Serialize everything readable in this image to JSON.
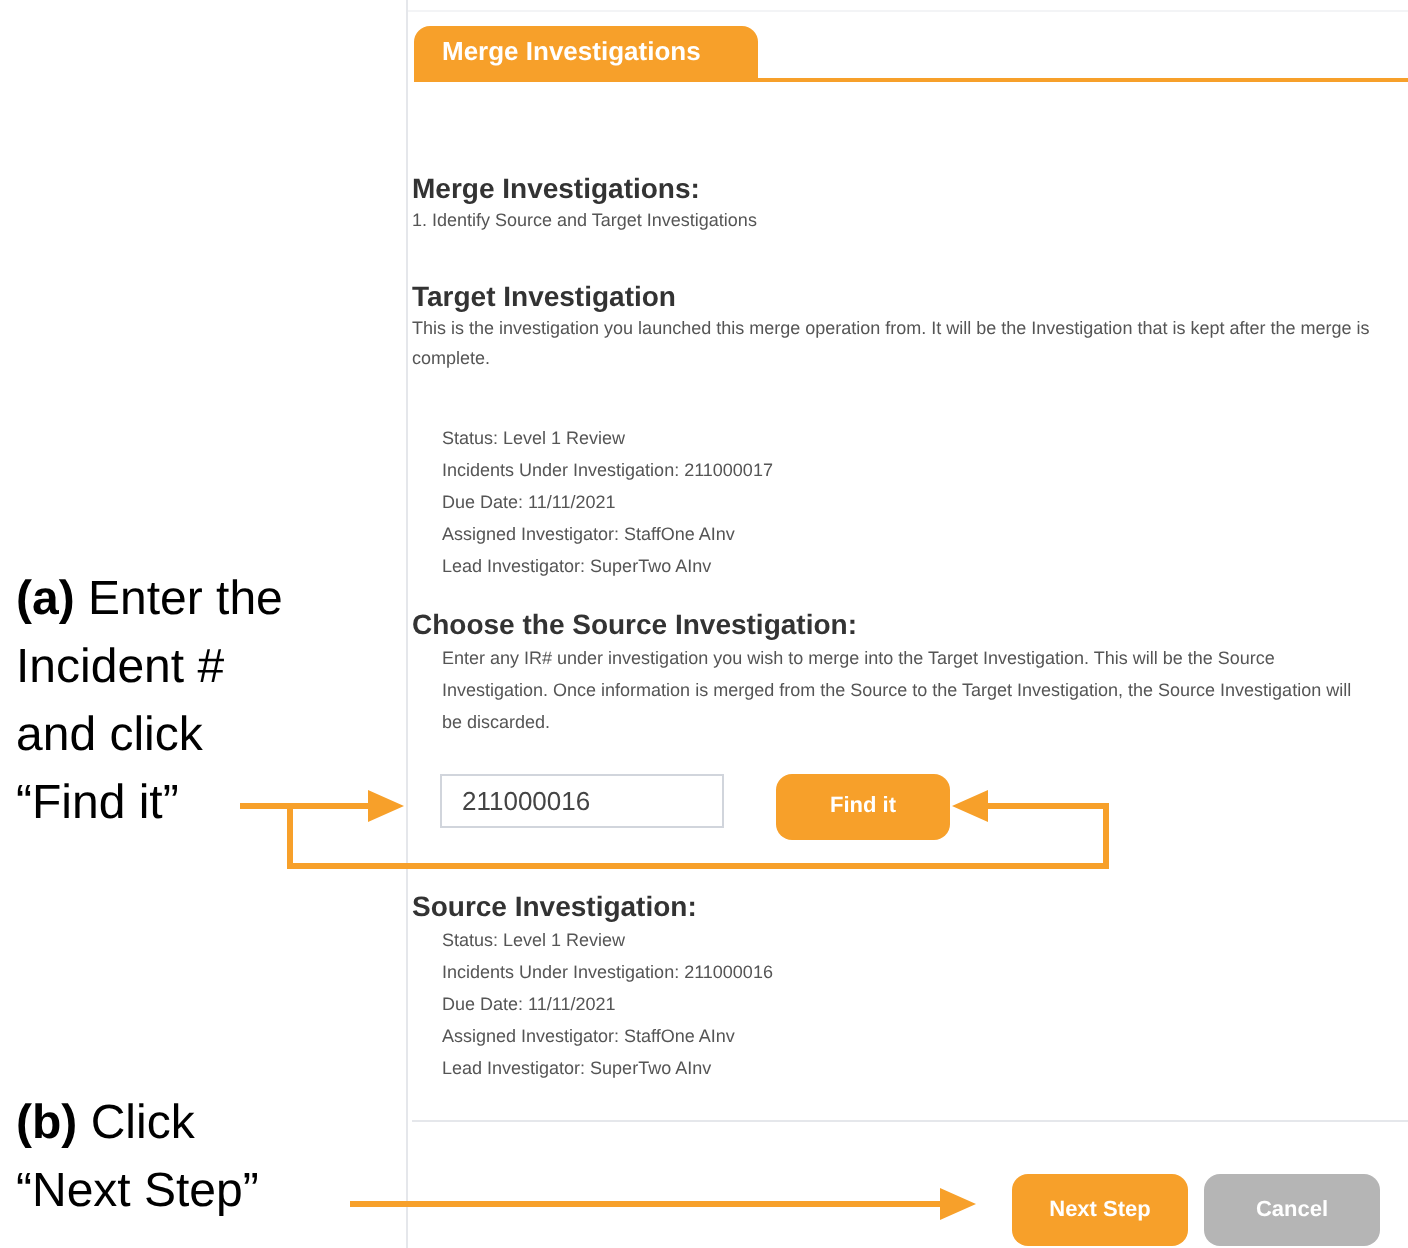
{
  "callouts": [
    {
      "lines": [
        "**(a)** Enter the",
        "Incident #",
        "and click",
        "“Find it”"
      ]
    },
    {
      "lines": [
        "**(b)** Click",
        "“Next Step”"
      ]
    }
  ],
  "tab": {
    "label": "Merge Investigations",
    "selected": true
  },
  "header": {
    "title": "Merge Investigations:",
    "step": "1. Identify Source and Target Investigations"
  },
  "target": {
    "title": "Target Investigation",
    "description": "This is the investigation you launched this merge operation from. It will be the Investigation that is kept after the merge is complete.",
    "details": [
      "Status: Level 1 Review",
      "Incidents Under Investigation: 211000017",
      "Due Date: 11/11/2021",
      "Assigned Investigator: StaffOne AInv",
      "Lead Investigator: SuperTwo AInv"
    ]
  },
  "source_search": {
    "title": "Choose the Source Investigation:",
    "description": "Enter any IR# under investigation you wish to merge into the Target Investigation. This will be the Source Investigation. Once information is merged from the Source to the Target Investigation, the Source Investigation will be discarded.",
    "input": {
      "value": "211000016"
    },
    "button": "Find it"
  },
  "source": {
    "title": "Source Investigation:",
    "details": [
      "Status: Level 1 Review",
      "Incidents Under Investigation: 211000016",
      "Due Date: 11/11/2021",
      "Assigned Investigator: StaffOne AInv",
      "Lead Investigator: SuperTwo AInv"
    ]
  },
  "buttons": [
    {
      "label": "Next Step",
      "kind": "primary"
    },
    {
      "label": "Cancel",
      "kind": "secondary"
    }
  ]
}
